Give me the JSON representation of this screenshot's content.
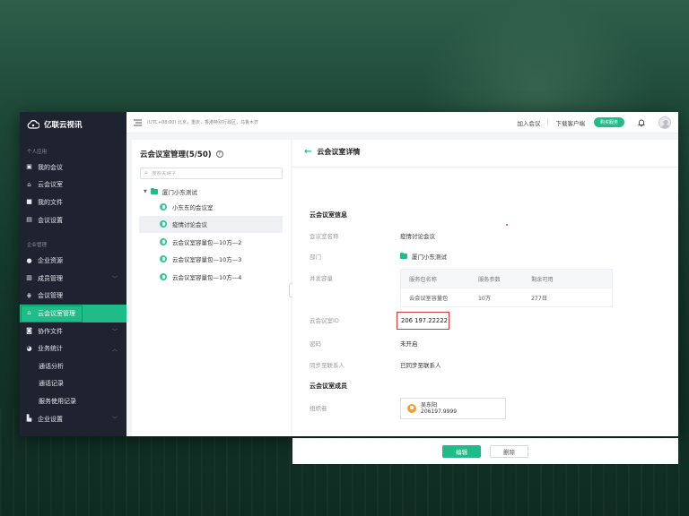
{
  "brand": {
    "name": "亿联云视讯",
    "accent": "#1fbc8a",
    "sidebar_bg": "#1f2330"
  },
  "sidebar": {
    "personal_section": "个人应用",
    "personal_items": [
      {
        "label": "我的会议",
        "icon": "calendar-icon"
      },
      {
        "label": "云会议室",
        "icon": "home-icon"
      },
      {
        "label": "我的文件",
        "icon": "folder-icon"
      },
      {
        "label": "会议设置",
        "icon": "settings-icon"
      }
    ],
    "enterprise_section": "企业管理",
    "enterprise_items": [
      {
        "label": "企业资源",
        "icon": "resource-icon"
      },
      {
        "label": "成员管理",
        "icon": "members-icon",
        "caret": "﹀"
      },
      {
        "label": "会议管理",
        "icon": "meeting-manage-icon"
      },
      {
        "label": "云会议室管理",
        "icon": "home-icon",
        "active": true
      },
      {
        "label": "协作文件",
        "icon": "file-icon",
        "caret": "﹀"
      },
      {
        "label": "业务统计",
        "icon": "stats-icon",
        "caret": "︿"
      }
    ],
    "stats_sub": [
      "通话分析",
      "通话记录",
      "服务使用记录"
    ],
    "settings_item": {
      "label": "企业设置",
      "icon": "building-icon",
      "caret": "﹀"
    }
  },
  "topbar": {
    "timezone": "(UTC+08:00) 北京，重庆，香港特别行政区，乌鲁木齐",
    "join_meeting": "加入会议",
    "download_client": "下载客户端",
    "buy_service": "购买服务"
  },
  "leftpanel": {
    "title": "云会议室管理(5/50)",
    "help": "?",
    "search_placeholder": "搜索关键字",
    "root": "厦门小东测试",
    "rooms": [
      {
        "label": "小东东的会议室"
      },
      {
        "label": "疫情讨论会议",
        "selected": true
      },
      {
        "label": "云会议室容量包—10方—2"
      },
      {
        "label": "云会议室容量包—10方—3"
      },
      {
        "label": "云会议室容量包—10方—4"
      }
    ]
  },
  "detail": {
    "header": "云会议室详情",
    "info_title": "云会议室信息",
    "name_label": "会议室名称",
    "name_value": "疫情讨论会议",
    "dept_label": "部门",
    "dept_value": "厦门小东测试",
    "capacity_label": "并发容量",
    "table_headers": [
      "服务包名称",
      "服务参数",
      "剩余可用"
    ],
    "table_rows": [
      [
        "云会议室容量包",
        "10方",
        "277日"
      ]
    ],
    "id_label": "云会议室ID",
    "id_value": "206 197.22222",
    "password_label": "密码",
    "password_value": "未开启",
    "sync_label": "同步至联系人",
    "sync_value": "已同步至联系人",
    "members_title": "云会议室成员",
    "organizer_label": "组织者",
    "organizer_name": "吴东阳",
    "organizer_id": "206197.9999",
    "edit_button": "编辑",
    "delete_button": "删除"
  }
}
